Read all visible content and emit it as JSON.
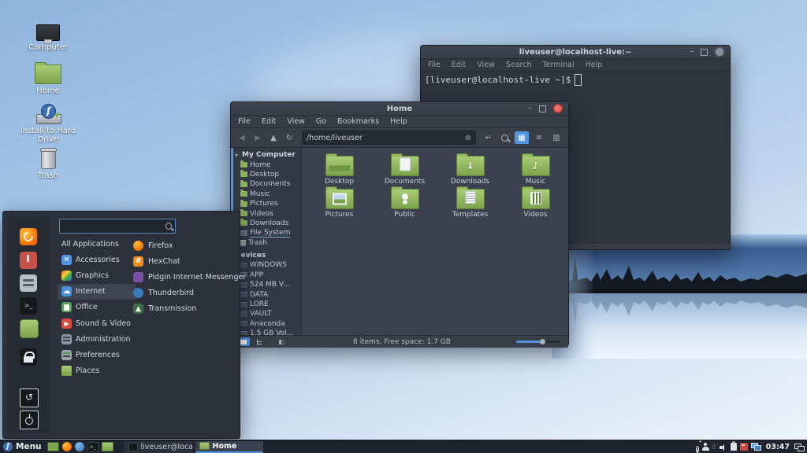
{
  "desktop_icons": [
    {
      "label": "Computer"
    },
    {
      "label": "Home"
    },
    {
      "label": "Install to Hard Drive"
    },
    {
      "label": "Trash"
    }
  ],
  "terminal": {
    "title": "liveuser@localhost-live:~",
    "menu": [
      "File",
      "Edit",
      "View",
      "Search",
      "Terminal",
      "Help"
    ],
    "prompt": "[liveuser@localhost-live ~]$"
  },
  "file_manager": {
    "title": "Home",
    "menu": [
      "File",
      "Edit",
      "View",
      "Go",
      "Bookmarks",
      "Help"
    ],
    "path": "/home/liveuser",
    "sidebar": {
      "section1_header": "My Computer",
      "section1_items": [
        "Home",
        "Desktop",
        "Documents",
        "Music",
        "Pictures",
        "Videos",
        "Downloads",
        "File System",
        "Trash"
      ],
      "section2_header": "Devices",
      "section2_items": [
        "WINDOWS",
        "APP",
        "524 MB V...",
        "DATA",
        "LORE",
        "VAULT",
        "Anaconda",
        "1.5 GB Vol..."
      ]
    },
    "files": [
      "Desktop",
      "Documents",
      "Downloads",
      "Music",
      "Pictures",
      "Public",
      "Templates",
      "Videos"
    ],
    "status_text": "8 items, Free space: 1.7 GB"
  },
  "menu_popup": {
    "search_value": "",
    "categories": [
      "All Applications",
      "Accessories",
      "Graphics",
      "Internet",
      "Office",
      "Sound & Video",
      "Administration",
      "Preferences",
      "Places"
    ],
    "selected_category": "Internet",
    "apps": [
      "Firefox",
      "HexChat",
      "Pidgin Internet Messenger",
      "Thunderbird",
      "Transmission"
    ]
  },
  "taskbar": {
    "menu_label": "Menu",
    "tasks": [
      {
        "label": "liveuser@localh..."
      },
      {
        "label": "Home"
      }
    ],
    "clock": "03:47",
    "notification_count": "1"
  },
  "glyphs": {
    "back": "◀",
    "forward": "▶",
    "up": "▲",
    "refresh": "↻",
    "clear": "⊗",
    "go": "↵",
    "view_icons": "▦",
    "view_list": "≡",
    "view_compact": "▥",
    "pane_toggle": "◧",
    "collapse_caret": "▾",
    "cloud": "☁",
    "play": "▶",
    "hash": "#",
    "times": "×",
    "download_arrow": "↓",
    "music_note": "♪",
    "undo": "↺",
    "minimize": "–",
    "terminal_glyph": ">_"
  },
  "colors": {
    "accent": "#5294e2",
    "folder_green": "#8bb158",
    "close_red": "#e95b5b",
    "fedora_blue": "#3c6eb4"
  }
}
